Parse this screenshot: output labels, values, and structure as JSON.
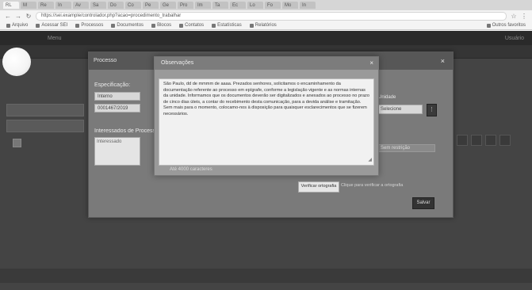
{
  "browser": {
    "tabs": [
      {
        "label": "RL"
      },
      {
        "label": "M"
      },
      {
        "label": "Re"
      },
      {
        "label": "In"
      },
      {
        "label": "Av"
      },
      {
        "label": "Sa"
      },
      {
        "label": "Do"
      },
      {
        "label": "Co"
      },
      {
        "label": "Pe"
      },
      {
        "label": "Ge"
      },
      {
        "label": "Pro"
      },
      {
        "label": "Im"
      },
      {
        "label": "Ta"
      },
      {
        "label": "Ec"
      },
      {
        "label": "Lo"
      },
      {
        "label": "Fo"
      },
      {
        "label": "Mo"
      },
      {
        "label": "In"
      }
    ],
    "url": "https://sei.example/controlador.php?acao=procedimento_trabalhar",
    "bookmarks": [
      "Arquivo",
      "Acessar SEI",
      "Processos",
      "Documentos",
      "Blocos",
      "Contatos",
      "Estatísticas",
      "Relatórios",
      "Outros favoritos"
    ]
  },
  "app": {
    "brand": "Menu",
    "user": "Usuário"
  },
  "outer_modal": {
    "title": "Processo",
    "close": "×",
    "label1": "Especificação:",
    "input1": "Interno",
    "input2": "0001467/2019",
    "label2": "Interessados de Processo",
    "textarea_placeholder": "Interessado",
    "right_label": "Unidade",
    "right_input": "Selecione",
    "right_field": "Sem restrição",
    "save": "Salvar"
  },
  "inner_modal": {
    "title": "Observações",
    "close": "×",
    "text": "São Paulo, dd de mmmm de aaaa. Prezados senhores, solicitamos o encaminhamento da documentação referente ao processo em epígrafe, conforme a legislação vigente e as normas internas da unidade. Informamos que os documentos deverão ser digitalizados e anexados ao processo no prazo de cinco dias úteis, a contar do recebimento desta comunicação, para a devida análise e tramitação. Sem mais para o momento, colocamo-nos à disposição para quaisquer esclarecimentos que se fizerem necessários.",
    "counter": "Até 4000 caracteres",
    "check_button": "Verificar ortografia",
    "check_info": "Clique para verificar a ortografia"
  }
}
